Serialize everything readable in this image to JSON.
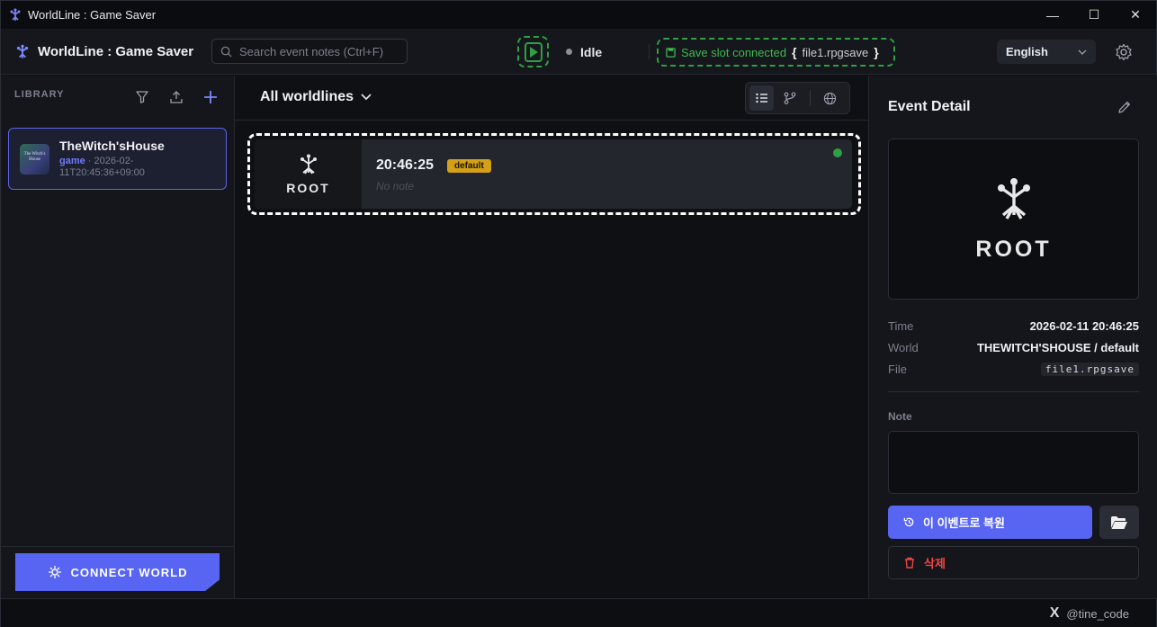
{
  "window": {
    "title": "WorldLine : Game Saver",
    "controls": {
      "minimize": "—",
      "maximize": "☐",
      "close": "✕"
    }
  },
  "header": {
    "brand": "WorldLine : Game Saver",
    "search_placeholder": "Search event notes (Ctrl+F)",
    "status": "Idle",
    "slot_status": "Save slot connected",
    "brace_open": "{",
    "slot_file": "file1.rpgsave",
    "brace_close": "}",
    "language": "English"
  },
  "sidebar": {
    "heading": "LIBRARY",
    "games": [
      {
        "title": "TheWitch'sHouse",
        "tag": "game",
        "meta": " · 2026-02-11T20:45:36+09:00",
        "thumb_text": "The Witch's House"
      }
    ],
    "connect_label": "CONNECT WORLD"
  },
  "main": {
    "worldline_select": "All worldlines",
    "events": [
      {
        "thumb_label": "ROOT",
        "time": "20:46:25",
        "badge": "default",
        "note": "No note"
      }
    ]
  },
  "detail": {
    "title": "Event Detail",
    "preview_label": "ROOT",
    "time_label": "Time",
    "time_value": "2026-02-11 20:46:25",
    "world_label": "World",
    "world_value": "THEWITCH'SHOUSE / default",
    "file_label": "File",
    "file_value": "file1.rpgsave",
    "note_label": "Note",
    "note_value": "",
    "restore_label": "이 이벤트로 복원",
    "delete_label": "삭제"
  },
  "footer": {
    "x_glyph": "X",
    "credit": "@tine_code"
  },
  "colors": {
    "accent": "#5865f2",
    "success": "#2ea043",
    "badge": "#d4a017",
    "danger": "#ef4444"
  }
}
